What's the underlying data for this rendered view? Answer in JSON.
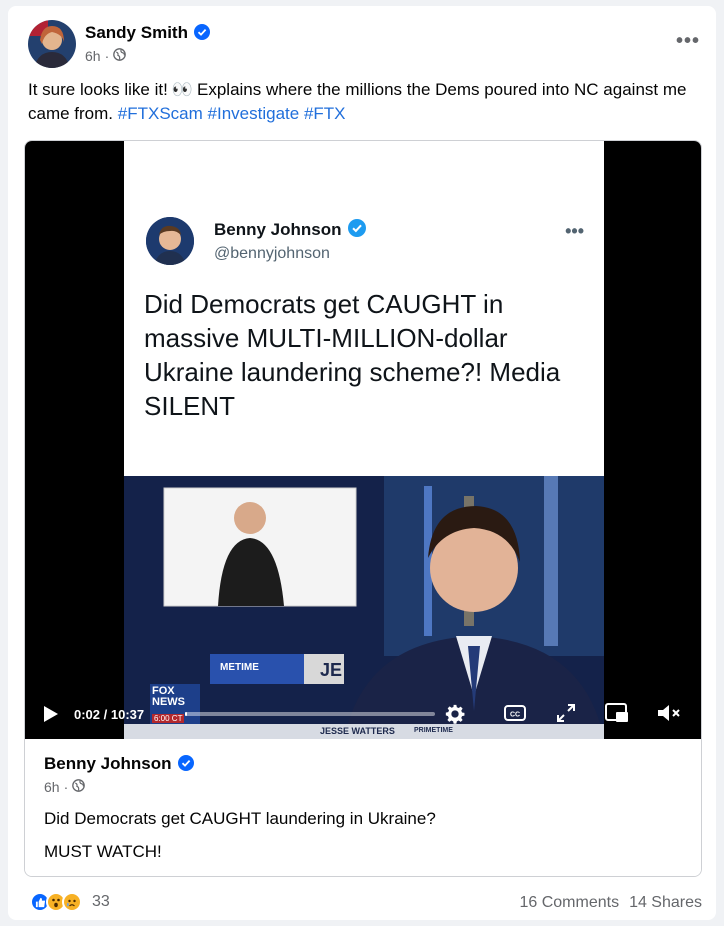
{
  "post": {
    "author": "Sandy Smith",
    "time": "6h",
    "text_before": "It sure looks like it!",
    "eyes_emoji": "👀",
    "text_after": "Explains where the millions the Dems poured into NC against me came from.",
    "hashtags": [
      "#FTXScam",
      "#Investigate",
      "#FTX"
    ]
  },
  "video": {
    "tweet_name": "Benny Johnson",
    "tweet_handle": "@bennyjohnson",
    "tweet_text": "Did Democrats get CAUGHT in massive MULTI-MILLION-dollar Ukraine laundering scheme?! Media SILENT",
    "time_display": "0:02 / 10:37",
    "fox_logo": "FOX NEWS",
    "chyron_time": "6:00 CT",
    "chyron": "JESSE WATTERS",
    "chyron_tag": "PRIMETIME",
    "bg_text_1": "METIME",
    "bg_text_2": "JE",
    "progress": 0.003
  },
  "embed": {
    "author": "Benny Johnson",
    "time": "6h",
    "line1": "Did Democrats get CAUGHT laundering in Ukraine?",
    "line2": "MUST WATCH!"
  },
  "footer": {
    "reaction_count": "33",
    "comments": "16 Comments",
    "shares": "14 Shares"
  },
  "colors": {
    "verified": "#0866ff",
    "hashtag": "#216fdb",
    "like": "#0866ff",
    "wow": "#f7b125"
  }
}
